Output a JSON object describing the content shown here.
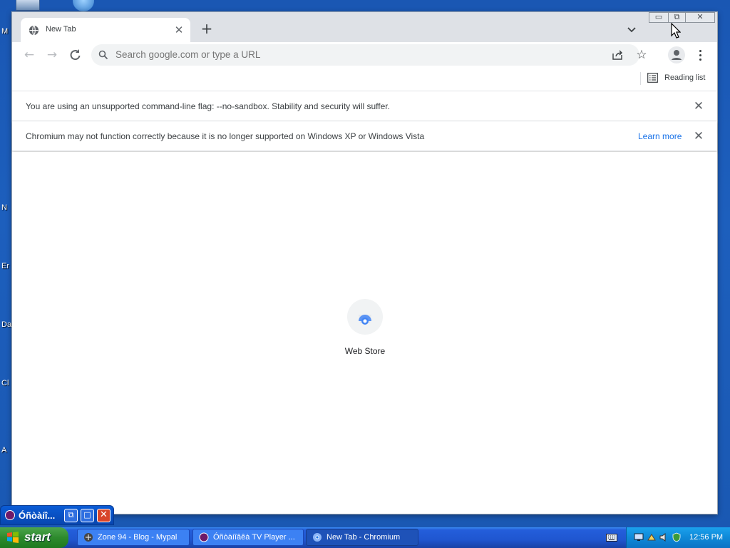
{
  "desktop": {
    "fragments": [
      "M",
      "N",
      "Er",
      "Da",
      "Cl",
      "A"
    ]
  },
  "browser": {
    "tab": {
      "title": "New Tab",
      "favicon": "globe-icon"
    },
    "window_controls": {
      "minimize": "minimize-icon",
      "maximize": "maximize-icon",
      "close": "close-icon"
    },
    "toolbar": {
      "omnibox_placeholder": "Search google.com or type a URL",
      "icons": [
        "back-icon",
        "forward-icon",
        "reload-icon",
        "search-icon",
        "share-icon",
        "star-icon",
        "profile-icon",
        "menu-icon"
      ]
    },
    "bookmarks": {
      "reading_list_label": "Reading list"
    },
    "infobars": [
      {
        "text": "You are using an unsupported command-line flag: --no-sandbox. Stability and security will suffer."
      },
      {
        "text": "Chromium may not function correctly because it is no longer supported on Windows XP or Windows Vista",
        "link": "Learn more"
      }
    ],
    "shortcuts": [
      {
        "label": "Web Store"
      }
    ]
  },
  "floating_window": {
    "title": "Óñòàíî..."
  },
  "taskbar": {
    "start_label": "start",
    "tasks": [
      {
        "label": "Zone 94 - Blog - Mypal",
        "active": false
      },
      {
        "label": "Óñòàíîâêà TV Player ...",
        "active": false
      },
      {
        "label": "New Tab - Chromium",
        "active": true
      }
    ],
    "clock": "12:56 PM"
  },
  "colors": {
    "accent": "#1a73e8",
    "taskbar": "#245edb",
    "start": "#2d8a2d",
    "tray": "#0e89d8"
  }
}
